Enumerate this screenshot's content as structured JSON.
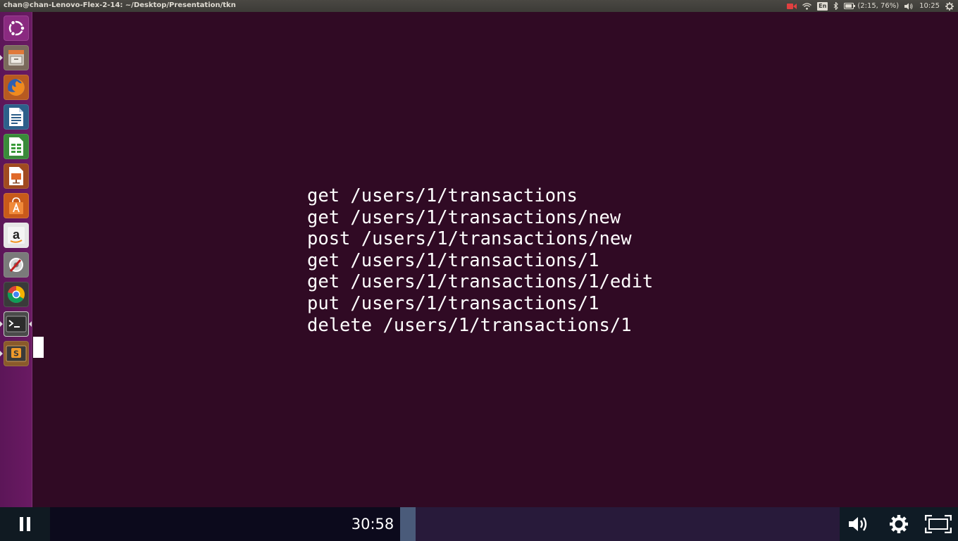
{
  "topbar": {
    "window_title": "chan@chan-Lenovo-Flex-2-14: ~/Desktop/Presentation/tkn",
    "icons": [
      "record-icon",
      "wifi-icon",
      "keyboard-layout-icon",
      "bluetooth-icon",
      "battery-icon",
      "volume-icon",
      "gear-icon"
    ],
    "keyboard_layout": "En",
    "battery_text": "(2:15, 76%)",
    "clock": "10:25"
  },
  "launcher": {
    "items": [
      {
        "name": "ubuntu-dash",
        "icon": "ubuntu-logo-icon"
      },
      {
        "name": "files",
        "icon": "file-cabinet-icon"
      },
      {
        "name": "firefox",
        "icon": "firefox-icon"
      },
      {
        "name": "libreoffice-writer",
        "icon": "writer-document-icon"
      },
      {
        "name": "libreoffice-calc",
        "icon": "calc-spreadsheet-icon"
      },
      {
        "name": "libreoffice-impress",
        "icon": "impress-presentation-icon"
      },
      {
        "name": "ubuntu-software-center",
        "icon": "shopping-bag-icon"
      },
      {
        "name": "amazon",
        "icon": "amazon-icon"
      },
      {
        "name": "system-settings",
        "icon": "settings-wrench-icon"
      },
      {
        "name": "chrome",
        "icon": "chrome-icon"
      },
      {
        "name": "terminal",
        "icon": "terminal-icon",
        "active": true
      },
      {
        "name": "sublime-text",
        "icon": "sublime-text-icon",
        "running": true
      }
    ]
  },
  "terminal": {
    "routes": [
      "get /users/1/transactions",
      "get /users/1/transactions/new",
      "post /users/1/transactions/new",
      "get /users/1/transactions/1",
      "get /users/1/transactions/1/edit",
      "put /users/1/transactions/1",
      "delete /users/1/transactions/1"
    ]
  },
  "player": {
    "state": "playing",
    "current_time": "30:58",
    "icons": [
      "pause-icon",
      "volume-icon",
      "gear-icon",
      "fullscreen-icon"
    ]
  },
  "colors": {
    "terminal_bg": "#300a24",
    "launcher_bg": "#5c1658",
    "controls_bg": "#0c0a1c",
    "text": "#ffffff"
  }
}
